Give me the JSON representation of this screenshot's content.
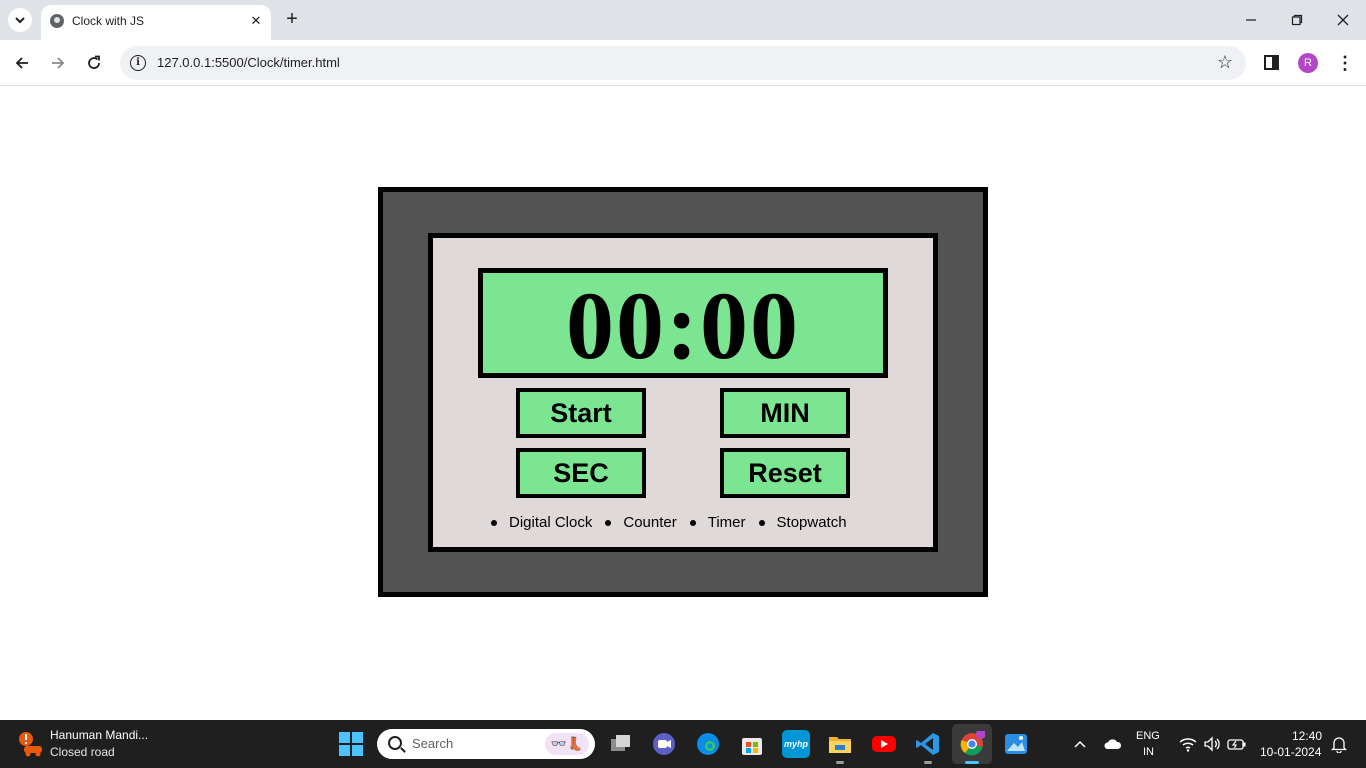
{
  "browser": {
    "tab_title": "Clock with JS",
    "tab_close_glyph": "✕",
    "new_tab_glyph": "+",
    "url": "127.0.0.1:5500/Clock/timer.html",
    "profile_initial": "R",
    "menu_glyph": "⋮",
    "star_glyph": "☆"
  },
  "timer": {
    "display": "00:00",
    "buttons": {
      "start": "Start",
      "min": "MIN",
      "sec": "SEC",
      "reset": "Reset"
    },
    "links": [
      "Digital Clock",
      "Counter",
      "Timer",
      "Stopwatch"
    ]
  },
  "taskbar": {
    "weather_title": "Hanuman Mandi...",
    "weather_sub": "Closed road",
    "search_placeholder": "Search",
    "language_top": "ENG",
    "language_bottom": "IN",
    "time": "12:40",
    "date": "10-01-2024",
    "app_labels": {
      "hp": "myhp"
    }
  },
  "colors": {
    "display_green": "#7be592",
    "panel_bg": "#dfd9d9",
    "frame_bg": "#535353",
    "taskbar_bg": "#1f1f1f",
    "accent_blue": "#4cc2ff",
    "profile_purple": "#b346c8"
  },
  "icons": {
    "tab_list": "chevron-down-icon",
    "back": "arrow-left-icon",
    "forward": "arrow-right-icon",
    "reload": "reload-icon",
    "site_info": "info-icon",
    "bookmark": "star-icon",
    "side_panel": "side-panel-icon"
  }
}
